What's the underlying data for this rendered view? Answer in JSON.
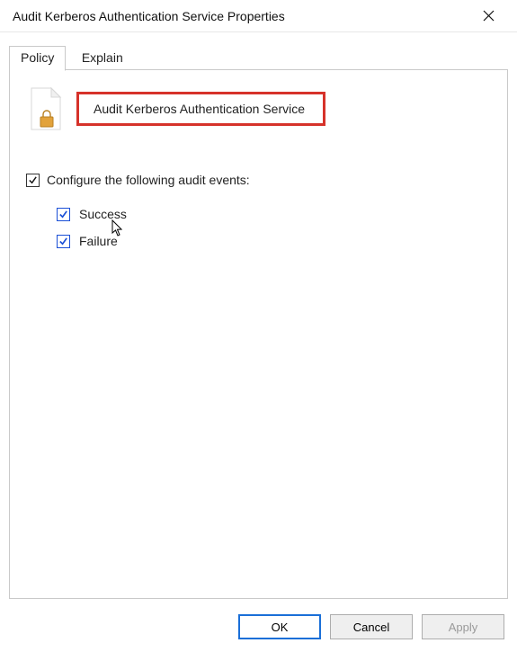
{
  "window": {
    "title": "Audit Kerberos Authentication Service Properties"
  },
  "tabs": [
    {
      "label": "Policy",
      "active": true
    },
    {
      "label": "Explain",
      "active": false
    }
  ],
  "policy": {
    "name": "Audit Kerberos Authentication Service",
    "configure_label": "Configure the following audit events:",
    "configure_checked": true,
    "options": [
      {
        "label": "Success",
        "checked": true
      },
      {
        "label": "Failure",
        "checked": true
      }
    ]
  },
  "buttons": {
    "ok": "OK",
    "cancel": "Cancel",
    "apply": "Apply"
  },
  "highlight_color": "#d6322a"
}
